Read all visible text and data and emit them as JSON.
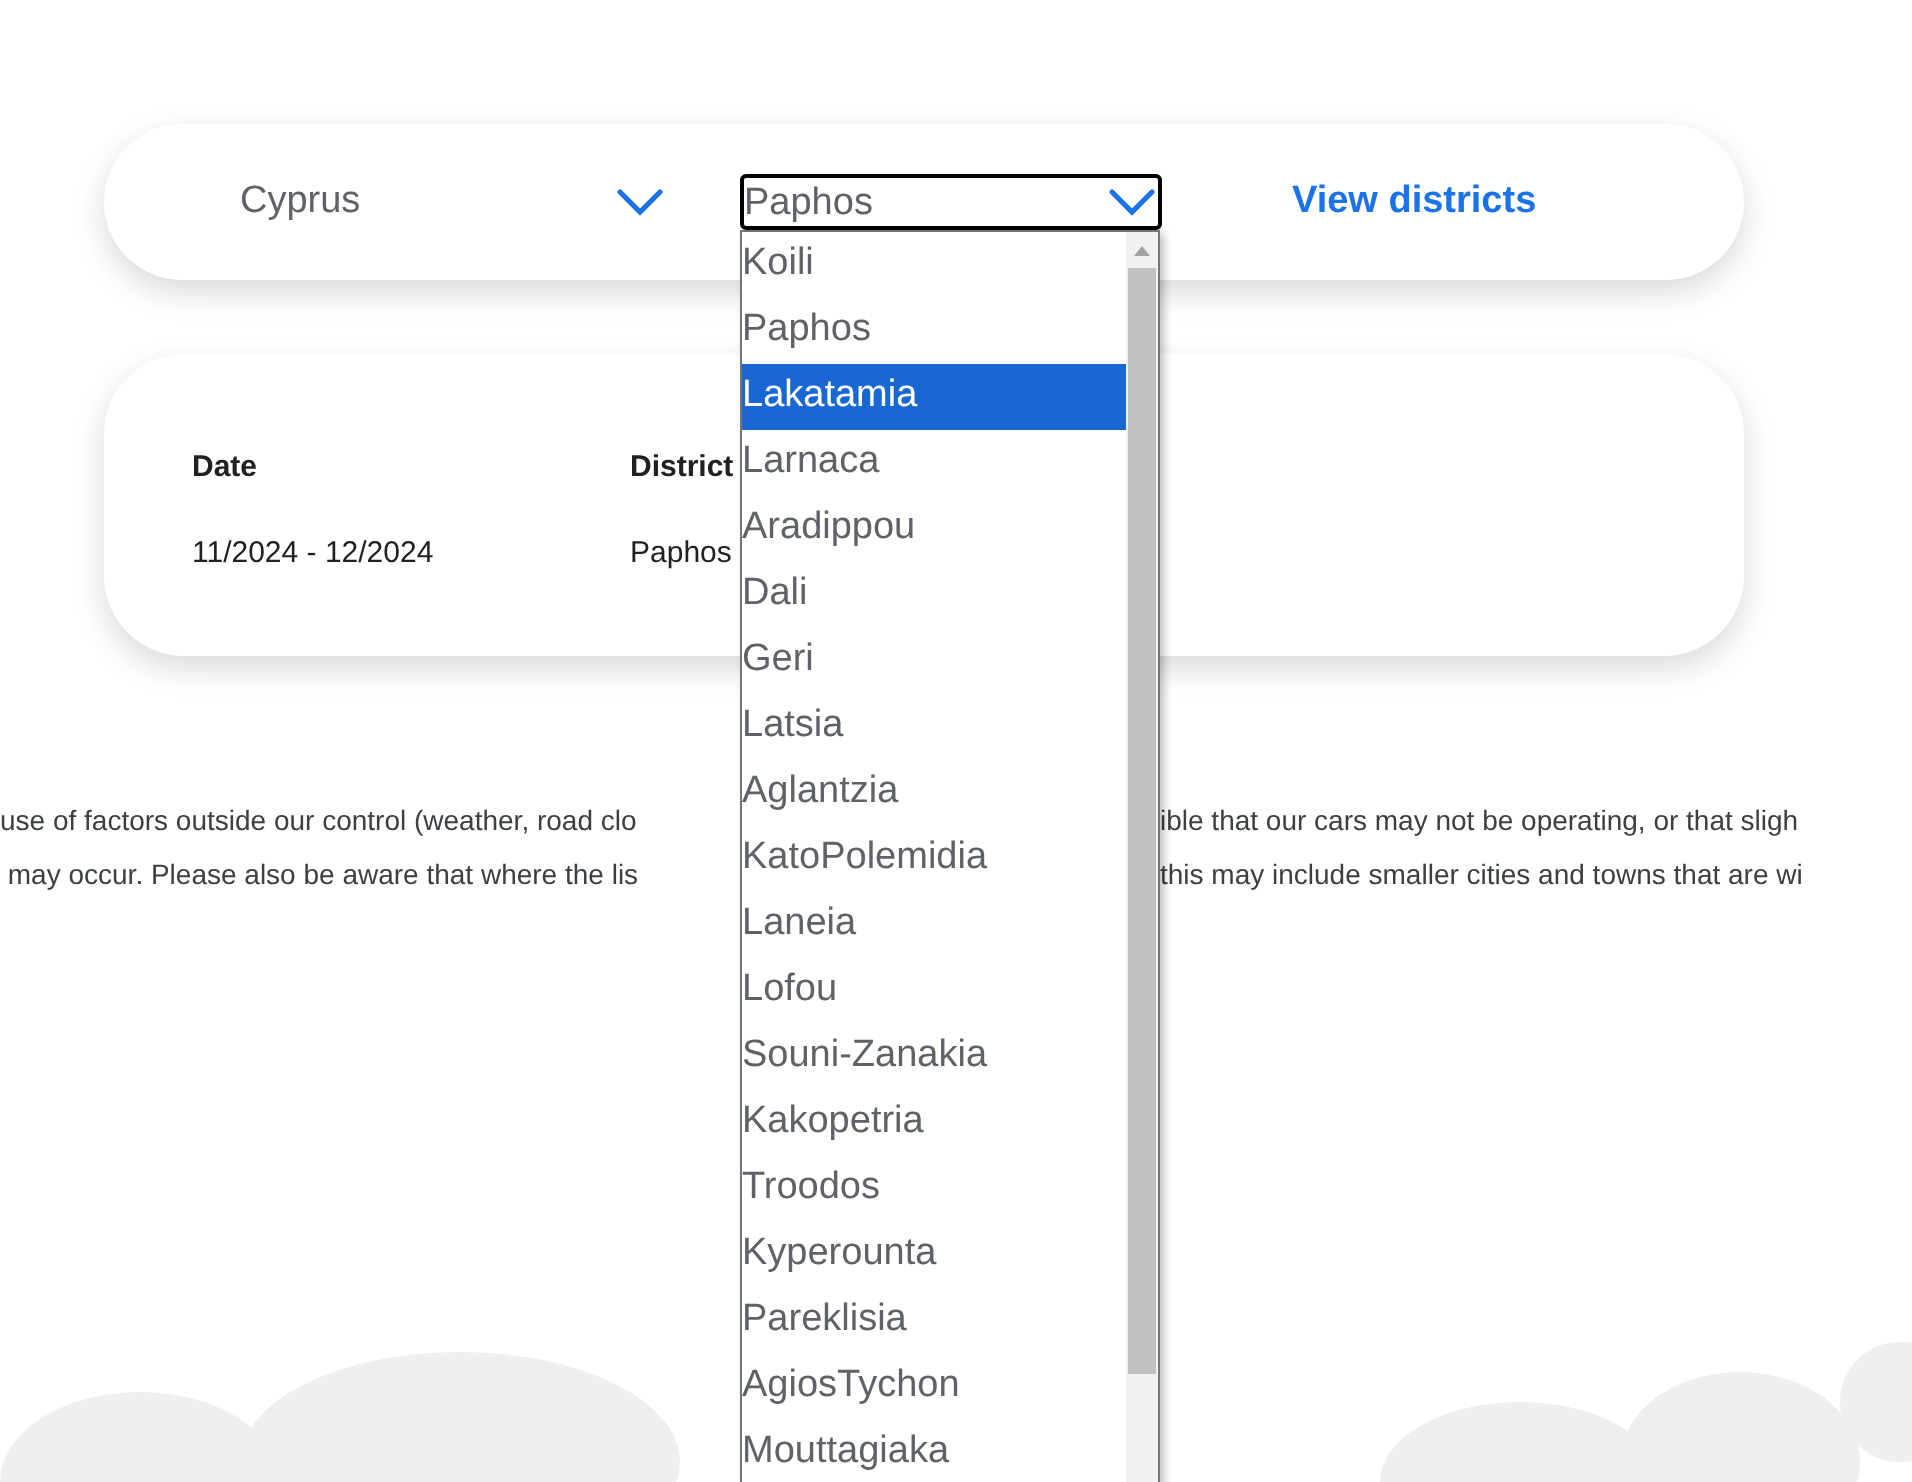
{
  "filter_bar": {
    "country_select": {
      "value": "Cyprus"
    },
    "district_select": {
      "value": "Paphos",
      "open": true
    },
    "view_link": "View districts"
  },
  "table": {
    "columns": [
      "Date",
      "District"
    ],
    "rows": [
      [
        "11/2024 - 12/2024",
        "Paphos"
      ]
    ]
  },
  "notice_lines": [
    {
      "left": "use of factors outside our control (weather, road clo",
      "right": "ible that our cars may not be operating, or that sligh"
    },
    {
      "left": " may occur. Please also be aware that where the lis",
      "right": "this may include smaller cities and towns that are wi"
    }
  ],
  "district_options": [
    {
      "label": "Koili",
      "selected": false
    },
    {
      "label": "Paphos",
      "selected": false
    },
    {
      "label": "Lakatamia",
      "selected": true
    },
    {
      "label": "Larnaca",
      "selected": false
    },
    {
      "label": "Aradippou",
      "selected": false
    },
    {
      "label": "Dali",
      "selected": false
    },
    {
      "label": "Geri",
      "selected": false
    },
    {
      "label": "Latsia",
      "selected": false
    },
    {
      "label": "Aglantzia",
      "selected": false
    },
    {
      "label": "KatoPolemidia",
      "selected": false
    },
    {
      "label": "Laneia",
      "selected": false
    },
    {
      "label": "Lofou",
      "selected": false
    },
    {
      "label": "Souni-Zanakia",
      "selected": false
    },
    {
      "label": "Kakopetria",
      "selected": false
    },
    {
      "label": "Troodos",
      "selected": false
    },
    {
      "label": "Kyperounta",
      "selected": false
    },
    {
      "label": "Pareklisia",
      "selected": false
    },
    {
      "label": "AgiosTychon",
      "selected": false
    },
    {
      "label": "Mouttagiaka",
      "selected": false
    }
  ]
}
